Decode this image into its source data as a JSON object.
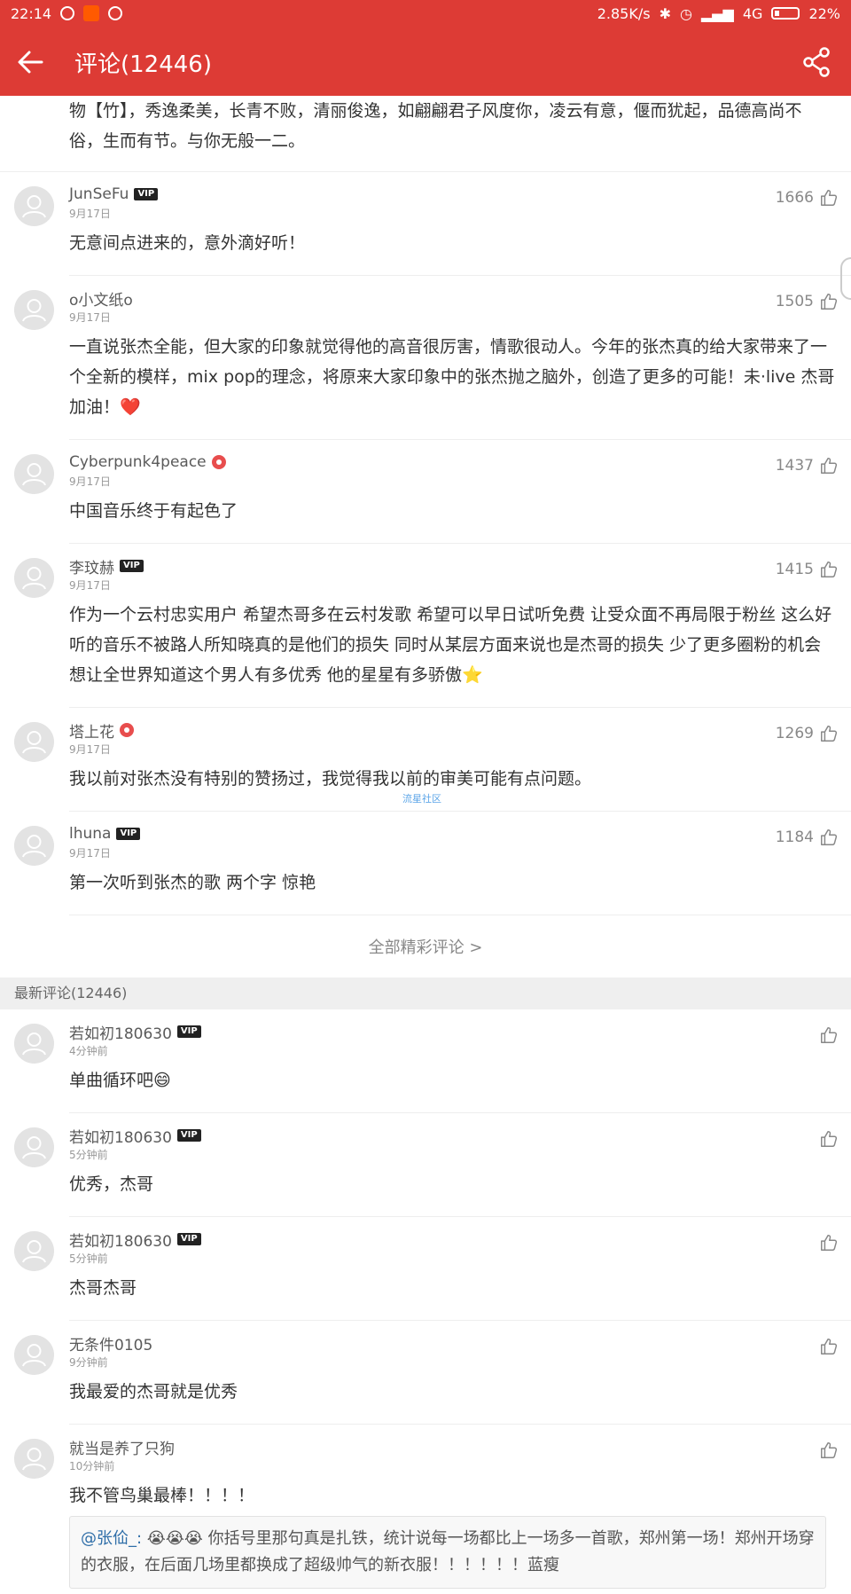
{
  "status_bar": {
    "time": "22:14",
    "speed": "2.85K/s",
    "network": "4G",
    "battery": "22%"
  },
  "header": {
    "title": "评论(12446)"
  },
  "continuation_text": "物【竹】，秀逸柔美，长青不败，清丽俊逸，如翩翩君子风度你，凌云有意，偃而犹起，品德高尚不俗，生而有节。与你无般一二。",
  "hot_comments": [
    {
      "user": "JunSeFu",
      "vip": true,
      "verified": false,
      "date": "9月17日",
      "likes": "1666",
      "text": "无意间点进来的，意外滴好听！"
    },
    {
      "user": "o小文纸o",
      "vip": false,
      "verified": false,
      "date": "9月17日",
      "likes": "1505",
      "text": "一直说张杰全能，但大家的印象就觉得他的高音很厉害，情歌很动人。今年的张杰真的给大家带来了一个全新的模样，mix pop的理念，将原来大家印象中的张杰抛之脑外，创造了更多的可能！未·live  杰哥加油！❤️"
    },
    {
      "user": "Cyberpunk4peace",
      "vip": false,
      "verified": true,
      "date": "9月17日",
      "likes": "1437",
      "text": "中国音乐终于有起色了"
    },
    {
      "user": "李玟赫",
      "vip": true,
      "verified": false,
      "date": "9月17日",
      "likes": "1415",
      "text": "作为一个云村忠实用户 希望杰哥多在云村发歌 希望可以早日试听免费 让受众面不再局限于粉丝 这么好听的音乐不被路人所知晓真的是他们的损失 同时从某层方面来说也是杰哥的损失 少了更多圈粉的机会  想让全世界知道这个男人有多优秀 他的星星有多骄傲⭐"
    },
    {
      "user": "塔上花",
      "vip": false,
      "verified": true,
      "date": "9月17日",
      "likes": "1269",
      "text": "我以前对张杰没有特别的赞扬过，我觉得我以前的审美可能有点问题。"
    },
    {
      "user": "lhuna",
      "vip": true,
      "verified": false,
      "date": "9月17日",
      "likes": "1184",
      "text": "第一次听到张杰的歌   两个字 惊艳"
    }
  ],
  "vip_badge": "VIP",
  "all_comments_link": "全部精彩评论 >",
  "latest_header": "最新评论(12446)",
  "latest_comments": [
    {
      "user": "若如初180630",
      "vip": true,
      "date": "4分钟前",
      "text": "单曲循环吧😄"
    },
    {
      "user": "若如初180630",
      "vip": true,
      "date": "5分钟前",
      "text": "优秀，杰哥"
    },
    {
      "user": "若如初180630",
      "vip": true,
      "date": "5分钟前",
      "text": "杰哥杰哥"
    },
    {
      "user": "无条件0105",
      "vip": false,
      "date": "9分钟前",
      "text": "我最爱的杰哥就是优秀"
    },
    {
      "user": "就当是养了只狗",
      "vip": false,
      "date": "10分钟前",
      "text": "我不管鸟巢最棒！！！！"
    }
  ],
  "quote": {
    "mention": "@张佡_:",
    "text": " 😭😭😭 你括号里那句真是扎铁，统计说每一场都比上一场多一首歌，郑州第一场！郑州开场穿的衣服，在后面几场里都换成了超级帅气的新衣服！！！！！！蓝瘦"
  },
  "watermark": "流星社区",
  "colors": {
    "brand": "#dd3b35",
    "like": "#888888",
    "link": "#2f6ea8"
  }
}
